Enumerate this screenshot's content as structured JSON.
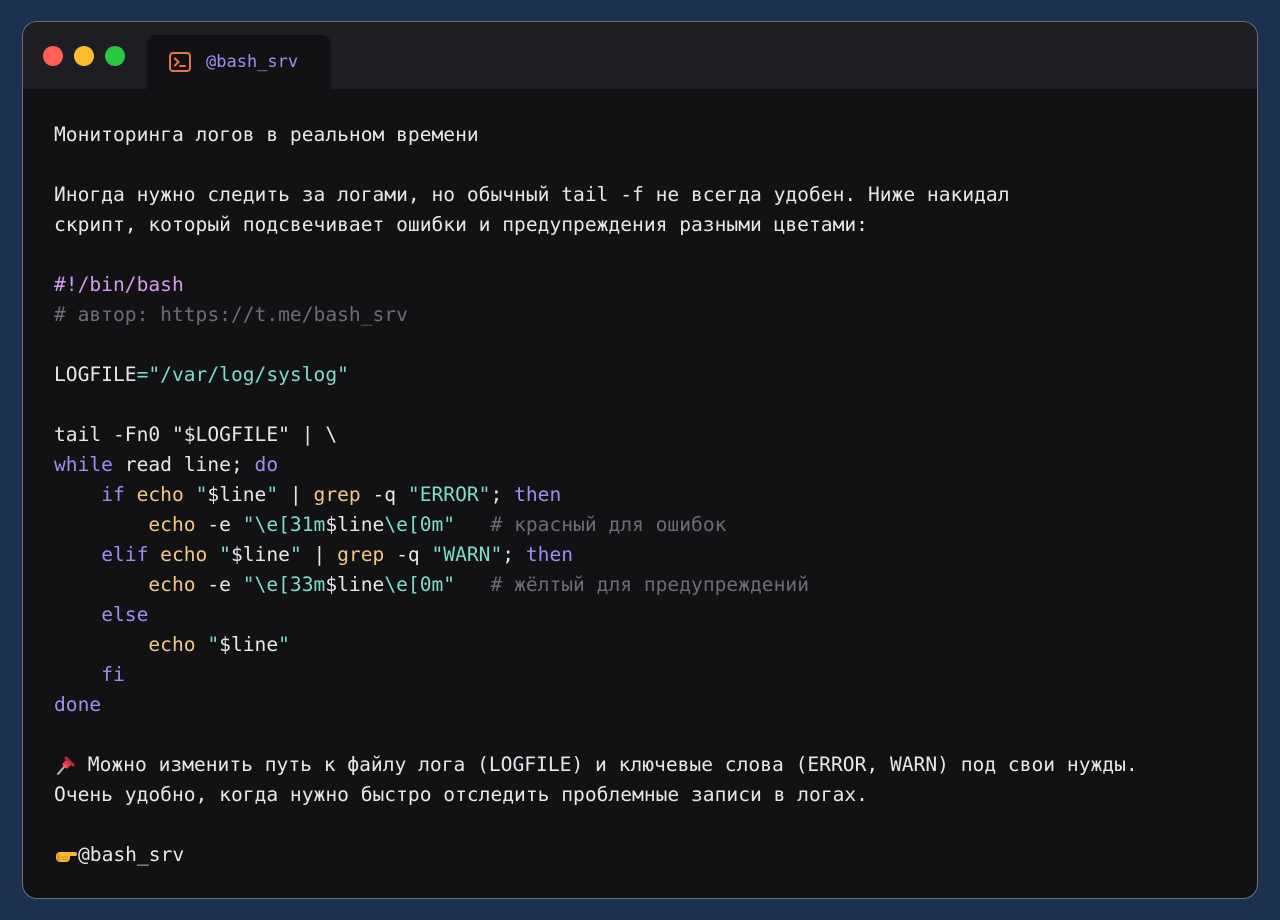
{
  "tab": {
    "label": "@bash_srv",
    "icon": "terminal-icon"
  },
  "colors": {
    "background": "#1b3150",
    "window": "#121215",
    "keyword": "#a48bf2",
    "string": "#7fdcc4",
    "command": "#f3c688",
    "comment": "#6c6c72",
    "shebang": "#d39af0"
  },
  "text": {
    "title": "Мониторинга логов в реальном времени",
    "intro1": "Иногда нужно следить за логами, но обычный tail -f не всегда удобен. Ниже накидал",
    "intro2": "скрипт, который подсвечивает ошибки и предупреждения разными цветами:",
    "note1": " Можно изменить путь к файлу лога (LOGFILE) и ключевые слова (ERROR, WARN) под свои нужды.",
    "note2": "Очень удобно, когда нужно быстро отследить проблемные записи в логах.",
    "signature": "@bash_srv",
    "pin_icon": "pin-icon",
    "hand_icon": "pointing-hand-icon"
  },
  "code": {
    "shebang": "#!/bin/bash",
    "author_comment": "# автор: https://t.me/bash_srv",
    "l3_var": "LOGFILE",
    "l3_eq": "=",
    "l3_str": "\"/var/log/syslog\"",
    "l4_cmd": "tail -Fn0 ",
    "l4_str_open": "\"",
    "l4_var": "$LOGFILE",
    "l4_str_close": "\"",
    "l4_pipe": " | \\",
    "l5_while": "while",
    "l5_mid": " read line; ",
    "l5_do": "do",
    "l6_indent": "    ",
    "l6_if": "if",
    "l6_sp1": " ",
    "l6_echo": "echo",
    "l6_sp2": " ",
    "l6_q1": "\"",
    "l6_var": "$line",
    "l6_q2": "\"",
    "l6_pipe": " | ",
    "l6_grep": "grep",
    "l6_opt": " -q ",
    "l6_str": "\"ERROR\"",
    "l6_semi": "; ",
    "l6_then": "then",
    "l7_indent": "        ",
    "l7_echo": "echo",
    "l7_opt": " -e ",
    "l7_q1": "\"",
    "l7_esc1": "\\e[31m",
    "l7_var": "$line",
    "l7_esc2": "\\e[0m",
    "l7_q2": "\"",
    "l7_gap": "   ",
    "l7_comment": "# красный для ошибок",
    "l8_indent": "    ",
    "l8_elif": "elif",
    "l8_sp1": " ",
    "l8_echo": "echo",
    "l8_sp2": " ",
    "l8_q1": "\"",
    "l8_var": "$line",
    "l8_q2": "\"",
    "l8_pipe": " | ",
    "l8_grep": "grep",
    "l8_opt": " -q ",
    "l8_str": "\"WARN\"",
    "l8_semi": "; ",
    "l8_then": "then",
    "l9_indent": "        ",
    "l9_echo": "echo",
    "l9_opt": " -e ",
    "l9_q1": "\"",
    "l9_esc1": "\\e[33m",
    "l9_var": "$line",
    "l9_esc2": "\\e[0m",
    "l9_q2": "\"",
    "l9_gap": "   ",
    "l9_comment": "# жёлтый для предупреждений",
    "l10_indent": "    ",
    "l10_else": "else",
    "l11_indent": "        ",
    "l11_echo": "echo",
    "l11_sp": " ",
    "l11_q1": "\"",
    "l11_var": "$line",
    "l11_q2": "\"",
    "l12_indent": "    ",
    "l12_fi": "fi",
    "l13_done": "done"
  }
}
